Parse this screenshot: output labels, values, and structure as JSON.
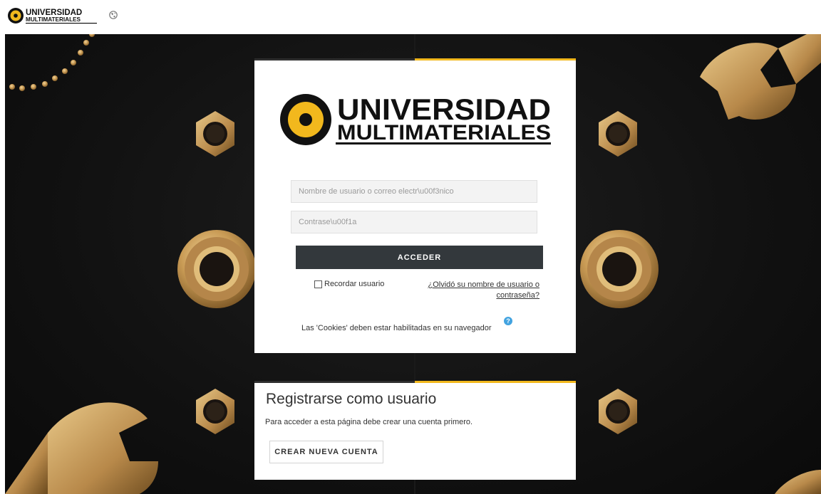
{
  "navbar": {
    "logo_line1": "UNIVERSIDAD",
    "logo_line2": "MULTIMATERIALES",
    "language_icon": "globe-icon"
  },
  "login": {
    "logo_line1": "UNIVERSIDAD",
    "logo_line2": "MULTIMATERIALES",
    "username_placeholder": "Nombre de usuario o correo electr\\u00f3nico",
    "password_placeholder": "Contrase\\u00f1a",
    "login_button": "ACCEDER",
    "remember_label": "Recordar usuario",
    "forgot_link": "¿Olvidó su nombre de usuario o contraseña?",
    "cookies_notice": "Las 'Cookies' deben estar habilitadas en su navegador",
    "help_icon": "question-circle-icon"
  },
  "signup": {
    "title": "Registrarse como usuario",
    "description": "Para acceder a esta página debe crear una cuenta primero.",
    "create_button": "CREAR NUEVA CUENTA"
  },
  "colors": {
    "accent_yellow": "#f2b81d",
    "button_dark": "#33383c",
    "help_blue": "#42a3e0"
  }
}
